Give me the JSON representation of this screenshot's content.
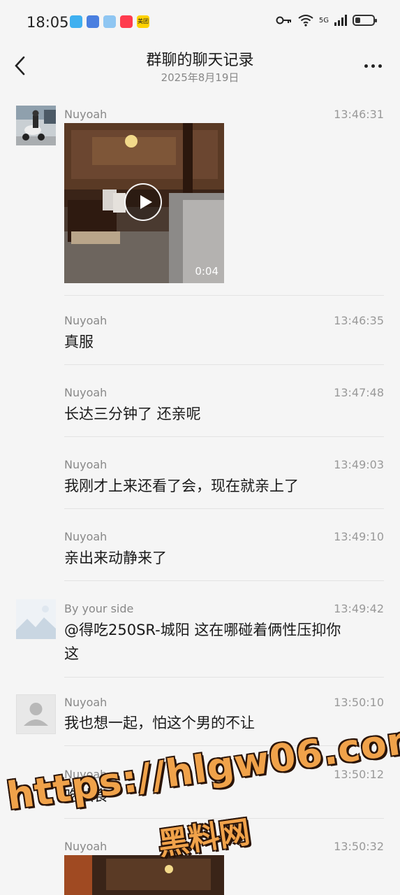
{
  "status_bar": {
    "time": "18:05",
    "network": "5G",
    "app_icons": [
      {
        "name": "app-icon-1",
        "color": "#3fb0f0",
        "label": ""
      },
      {
        "name": "app-icon-2",
        "color": "#4a7fe0",
        "label": ""
      },
      {
        "name": "app-icon-3",
        "color": "#8fc6f2",
        "label": ""
      },
      {
        "name": "app-icon-4",
        "color": "#ff3b4e",
        "label": ""
      },
      {
        "name": "meituan-icon",
        "color": "#ffd200",
        "label": "美团"
      }
    ],
    "battery_level": 0.3
  },
  "header": {
    "title": "群聊的聊天记录",
    "date": "2025年8月19日"
  },
  "messages": [
    {
      "sender": "Nuyoah",
      "time": "13:46:31",
      "avatar": "scooter-rider-photo",
      "video_duration": "0:04"
    },
    {
      "sender": "Nuyoah",
      "time": "13:46:35",
      "text": "真服"
    },
    {
      "sender": "Nuyoah",
      "time": "13:47:48",
      "text": "长达三分钟了 还亲呢"
    },
    {
      "sender": "Nuyoah",
      "time": "13:49:03",
      "text": "我刚才上来还看了会，现在就亲上了"
    },
    {
      "sender": "Nuyoah",
      "time": "13:49:10",
      "text": "亲出来动静来了"
    },
    {
      "sender": "By your side",
      "time": "13:49:42",
      "avatar": "landscape-placeholder",
      "text_line1": "@得吃250SR-城阳 这在哪碰着俩性压抑你",
      "text_line2": "这"
    },
    {
      "sender": "Nuyoah",
      "time": "13:50:10",
      "avatar": "default-person-avatar",
      "text": "我也想一起，怕这个男的不让"
    },
    {
      "sender": "Nuyoah",
      "time": "13:50:12",
      "text": "吃独食"
    },
    {
      "sender": "Nuyoah",
      "time": "13:50:32"
    }
  ],
  "watermark": {
    "url": "https://hlgw06.com",
    "name": "黑料网"
  },
  "colors": {
    "background": "#f5f5f5",
    "watermark": "#f0a24a"
  }
}
